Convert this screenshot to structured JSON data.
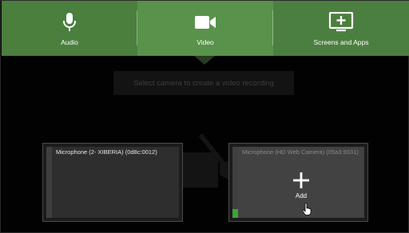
{
  "tabs": [
    {
      "label": "Audio",
      "icon": "microphone-icon",
      "active": false
    },
    {
      "label": "Video",
      "icon": "video-camera-icon",
      "active": true
    },
    {
      "label": "Screens and Apps",
      "icon": "screen-add-icon",
      "active": false
    }
  ],
  "hint": "Select camera to create a video recording",
  "devices": [
    {
      "title": "Microphone (2- XIBERIA) (0d8c:0012)",
      "level": 0
    },
    {
      "title": "Microphone (HD Web Camera) (05a3:9331)",
      "level": 0.12,
      "add_label": "Add"
    }
  ],
  "colors": {
    "tab_bg": "#477a3b",
    "tab_active_bg": "#59924a",
    "level_green": "#3fa337",
    "background": "#020202"
  }
}
